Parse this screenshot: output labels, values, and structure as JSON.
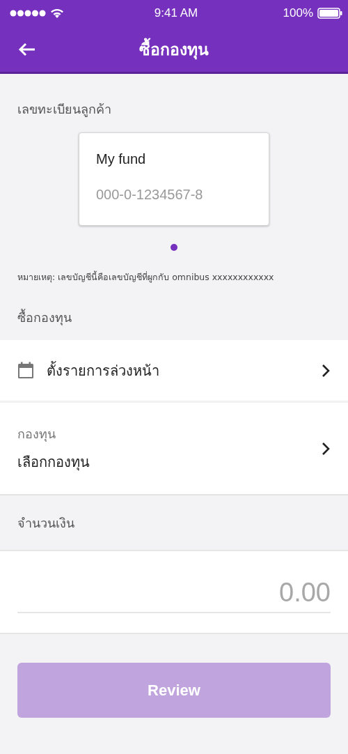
{
  "status_bar": {
    "time": "9:41 AM",
    "battery": "100%"
  },
  "header": {
    "title": "ซื้อกองทุน"
  },
  "account": {
    "label": "เลขทะเบียนลูกค้า",
    "cards": [
      {
        "name": "My fund",
        "number": "000-0-1234567-8"
      }
    ],
    "page_dots": [
      {
        "selected": true
      }
    ],
    "note": "หมายเหตุ: เลขบัญชีนี้คือเลขบัญชีที่ผูกกับ omnibus xxxxxxxxxxxx"
  },
  "purchase": {
    "label": "ซื้อกองทุน",
    "rows": [
      {
        "kind": "icon",
        "text": "ตั้งรายการล่วงหน้า"
      },
      {
        "kind": "field",
        "caption": "กองทุน",
        "text": "เลือกกองทุน"
      }
    ]
  },
  "amount": {
    "label": "จำนวนเงิน",
    "placeholder": "0.00"
  },
  "review_button": {
    "label": "Review",
    "disabled": true
  }
}
